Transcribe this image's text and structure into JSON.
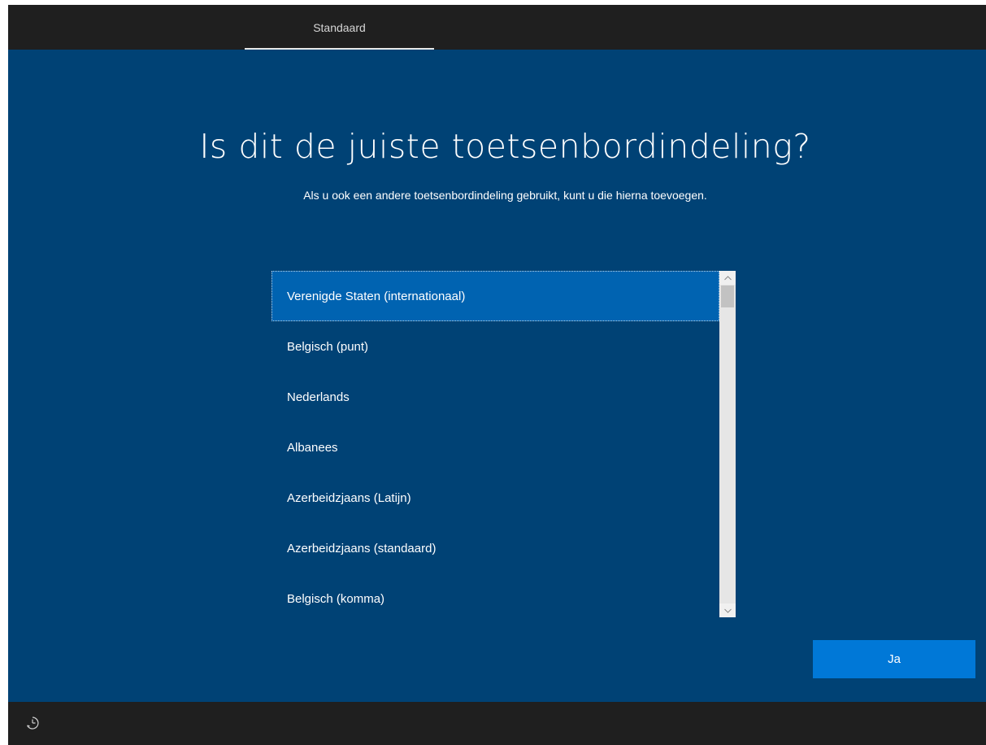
{
  "topbar": {
    "tabs": [
      {
        "label": "Standaard",
        "active": true
      }
    ]
  },
  "main": {
    "title": "Is dit de juiste toetsenbordindeling?",
    "subtitle": "Als u ook een andere toetsenbordindeling gebruikt, kunt u die hierna toevoegen."
  },
  "keyboard_list": {
    "selected_index": 0,
    "items": [
      "Verenigde Staten (internationaal)",
      "Belgisch (punt)",
      "Nederlands",
      "Albanees",
      "Azerbeidzjaans (Latijn)",
      "Azerbeidzjaans (standaard)",
      "Belgisch (komma)"
    ]
  },
  "actions": {
    "confirm_label": "Ja"
  },
  "bottombar": {
    "icons": [
      "ease-of-access-icon"
    ]
  },
  "colors": {
    "background": "#004275",
    "bar": "#1f1f1f",
    "selected": "#0063b1",
    "accent_button": "#0078d7"
  }
}
